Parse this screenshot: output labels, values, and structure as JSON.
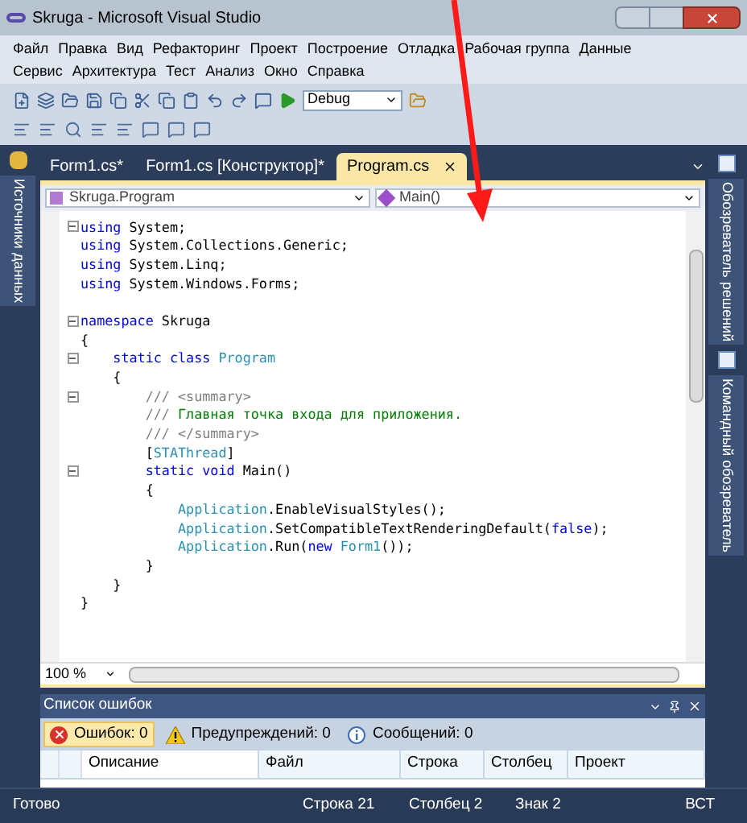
{
  "window": {
    "title": "Skruga - Microsoft Visual Studio"
  },
  "menu": [
    [
      "Файл",
      "Правка",
      "Вид",
      "Рефакторинг",
      "Проект",
      "Построение",
      "Отладка",
      "Рабочая группа",
      "Данные"
    ],
    [
      "Сервис",
      "Архитектура",
      "Тест",
      "Анализ",
      "Окно",
      "Справка"
    ]
  ],
  "toolbar": {
    "configuration": "Debug"
  },
  "left_panel": {
    "label": "Источники данных"
  },
  "right_panel": [
    {
      "label": "Обозреватель решений"
    },
    {
      "label": "Командный обозреватель"
    }
  ],
  "tabs": [
    {
      "label": "Form1.cs*",
      "selected": false
    },
    {
      "label": "Form1.cs [Конструктор]*",
      "selected": false
    },
    {
      "label": "Program.cs",
      "selected": true
    }
  ],
  "navigation": {
    "type": "Skruga.Program",
    "member": "Main()"
  },
  "code": [
    {
      "fold": true,
      "tokens": [
        {
          "kind": "keyword",
          "text": "using"
        },
        {
          "kind": "plain",
          "text": " System;"
        }
      ]
    },
    {
      "fold": false,
      "tokens": [
        {
          "kind": "keyword",
          "text": "using"
        },
        {
          "kind": "plain",
          "text": " System.Collections.Generic;"
        }
      ]
    },
    {
      "fold": false,
      "tokens": [
        {
          "kind": "keyword",
          "text": "using"
        },
        {
          "kind": "plain",
          "text": " System.Linq;"
        }
      ]
    },
    {
      "fold": false,
      "tokens": [
        {
          "kind": "keyword",
          "text": "using"
        },
        {
          "kind": "plain",
          "text": " System.Windows.Forms;"
        }
      ]
    },
    {
      "fold": false
    },
    {
      "fold": true,
      "tokens": [
        {
          "kind": "keyword",
          "text": "namespace"
        },
        {
          "kind": "plain",
          "text": " Skruga"
        }
      ]
    },
    {
      "fold": false,
      "tokens": [
        {
          "kind": "plain",
          "text": "{"
        }
      ]
    },
    {
      "fold": true,
      "tokens": [
        {
          "kind": "keyword",
          "text": "    static class "
        },
        {
          "kind": "type",
          "text": "Program"
        }
      ]
    },
    {
      "fold": false,
      "tokens": [
        {
          "kind": "plain",
          "text": "    {"
        }
      ]
    },
    {
      "fold": true,
      "tokens": [
        {
          "kind": "doc",
          "text": "        /// <summary>"
        }
      ]
    },
    {
      "fold": false,
      "tokens": [
        {
          "kind": "doc",
          "text": "        /// "
        },
        {
          "kind": "comment",
          "text": "Главная точка входа для приложения."
        }
      ]
    },
    {
      "fold": false,
      "tokens": [
        {
          "kind": "doc",
          "text": "        /// </summary>"
        }
      ]
    },
    {
      "fold": false,
      "tokens": [
        {
          "kind": "plain",
          "text": "        ["
        },
        {
          "kind": "type",
          "text": "STAThread"
        },
        {
          "kind": "plain",
          "text": "]"
        }
      ]
    },
    {
      "fold": true,
      "tokens": [
        {
          "kind": "keyword",
          "text": "        static void"
        },
        {
          "kind": "plain",
          "text": " Main()"
        }
      ]
    },
    {
      "fold": false,
      "tokens": [
        {
          "kind": "plain",
          "text": "        {"
        }
      ]
    },
    {
      "fold": false,
      "tokens": [
        {
          "kind": "type",
          "text": "            Application"
        },
        {
          "kind": "plain",
          "text": ".EnableVisualStyles();"
        }
      ]
    },
    {
      "fold": false,
      "tokens": [
        {
          "kind": "type",
          "text": "            Application"
        },
        {
          "kind": "plain",
          "text": ".SetCompatibleTextRenderingDefault("
        },
        {
          "kind": "keyword",
          "text": "false"
        },
        {
          "kind": "plain",
          "text": ");"
        }
      ]
    },
    {
      "fold": false,
      "tokens": [
        {
          "kind": "type",
          "text": "            Application"
        },
        {
          "kind": "plain",
          "text": ".Run("
        },
        {
          "kind": "keyword",
          "text": "new "
        },
        {
          "kind": "type",
          "text": "Form1"
        },
        {
          "kind": "plain",
          "text": "());"
        }
      ]
    },
    {
      "fold": false,
      "tokens": [
        {
          "kind": "plain",
          "text": "        }"
        }
      ]
    },
    {
      "fold": false,
      "tokens": [
        {
          "kind": "plain",
          "text": "    }"
        }
      ]
    },
    {
      "fold": false,
      "tokens": [
        {
          "kind": "plain",
          "text": "}"
        }
      ]
    }
  ],
  "zoom": "100 %",
  "error_list": {
    "title": "Список ошибок",
    "filters": [
      {
        "kind": "error",
        "label": "Ошибок: 0",
        "selected": true
      },
      {
        "kind": "warning",
        "label": "Предупреждений: 0",
        "selected": false
      },
      {
        "kind": "info",
        "label": "Сообщений: 0",
        "selected": false
      }
    ],
    "columns": [
      "Описание",
      "Файл",
      "Строка",
      "Столбец",
      "Проект"
    ]
  },
  "status_bar": {
    "message": "Готово",
    "line": "Строка 21",
    "column": "Столбец 2",
    "char": "Знак 2",
    "mode": "ВСТ"
  }
}
